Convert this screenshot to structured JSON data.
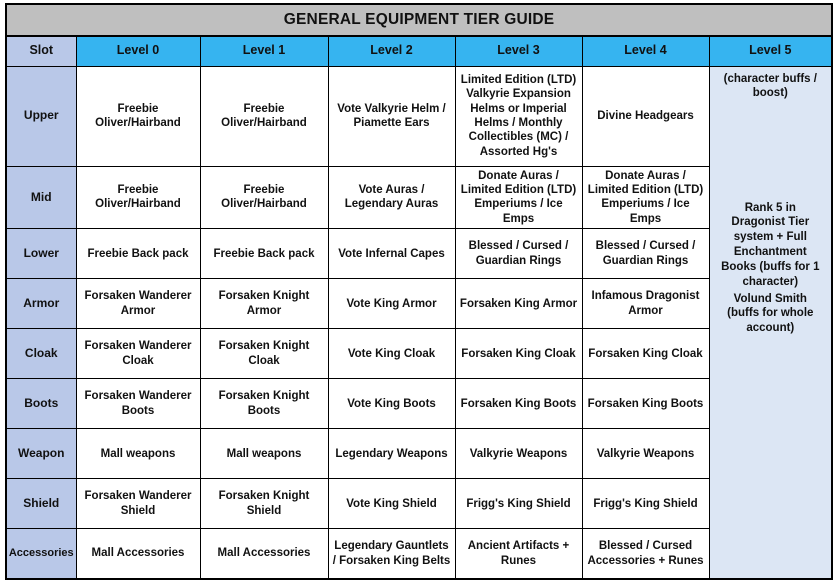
{
  "title": "GENERAL EQUIPMENT TIER GUIDE",
  "colors": {
    "title_background": "#bfbfbf",
    "header_level_background": "#36b4f0",
    "header_slot_background": "#b9c8e8",
    "slot_column_background": "#b9c8e8",
    "level5_background": "#dce6f4",
    "cell_background": "#ffffff",
    "border": "#000000",
    "text": "#111111"
  },
  "columns": [
    "Slot",
    "Level 0",
    "Level 1",
    "Level 2",
    "Level 3",
    "Level 4",
    "Level 5"
  ],
  "level5": {
    "top_note": "(character buffs / boost)",
    "middle_note": "Rank 5 in Dragonist Tier system + Full Enchantment Books (buffs for 1 character)",
    "bottom_note": "Volund Smith (buffs for whole account)"
  },
  "rows": [
    {
      "slot": "Upper",
      "level0": "Freebie Oliver/Hairband",
      "level1": "Freebie Oliver/Hairband",
      "level2": "Vote Valkyrie Helm / Piamette Ears",
      "level3": "Limited Edition (LTD) Valkyrie Expansion Helms or Imperial Helms / Monthly Collectibles (MC) / Assorted Hg's",
      "level4": "Divine Headgears"
    },
    {
      "slot": "Mid",
      "level0": "Freebie Oliver/Hairband",
      "level1": "Freebie Oliver/Hairband",
      "level2": "Vote Auras / Legendary Auras",
      "level3": "Donate Auras / Limited Edition (LTD) Emperiums / Ice Emps",
      "level4": "Donate Auras / Limited Edition (LTD) Emperiums / Ice Emps"
    },
    {
      "slot": "Lower",
      "level0": "Freebie Back pack",
      "level1": "Freebie Back pack",
      "level2": "Vote Infernal Capes",
      "level3": "Blessed / Cursed / Guardian Rings",
      "level4": "Blessed / Cursed / Guardian Rings"
    },
    {
      "slot": "Armor",
      "level0": "Forsaken Wanderer Armor",
      "level1": "Forsaken Knight Armor",
      "level2": "Vote King Armor",
      "level3": "Forsaken King Armor",
      "level4": "Infamous Dragonist Armor"
    },
    {
      "slot": "Cloak",
      "level0": "Forsaken Wanderer Cloak",
      "level1": "Forsaken Knight Cloak",
      "level2": "Vote King Cloak",
      "level3": "Forsaken King Cloak",
      "level4": "Forsaken King Cloak"
    },
    {
      "slot": "Boots",
      "level0": "Forsaken Wanderer Boots",
      "level1": "Forsaken Knight Boots",
      "level2": "Vote King Boots",
      "level3": "Forsaken King Boots",
      "level4": "Forsaken King Boots"
    },
    {
      "slot": "Weapon",
      "level0": "Mall weapons",
      "level1": "Mall weapons",
      "level2": "Legendary Weapons",
      "level3": "Valkyrie Weapons",
      "level4": "Valkyrie Weapons"
    },
    {
      "slot": "Shield",
      "level0": "Forsaken Wanderer Shield",
      "level1": "Forsaken Knight Shield",
      "level2": "Vote King Shield",
      "level3": "Frigg's King Shield",
      "level4": "Frigg's King Shield"
    },
    {
      "slot": "Accessories",
      "level0": "Mall Accessories",
      "level1": "Mall Accessories",
      "level2": "Legendary Gauntlets / Forsaken King Belts",
      "level3": "Ancient Artifacts + Runes",
      "level4": "Blessed / Cursed Accessories + Runes"
    }
  ]
}
